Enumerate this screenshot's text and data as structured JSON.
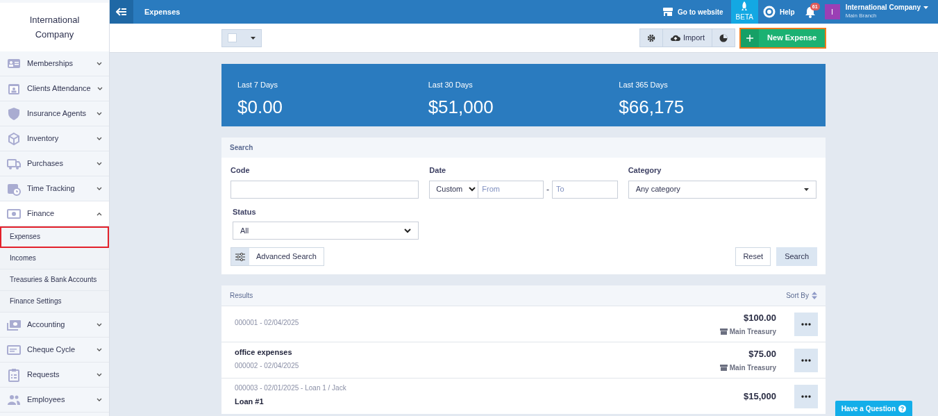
{
  "sidebar": {
    "company": "International Company",
    "items": [
      {
        "label": "Memberships",
        "expanded": false
      },
      {
        "label": "Clients Attendance",
        "expanded": false
      },
      {
        "label": "Insurance Agents",
        "expanded": false
      },
      {
        "label": "Inventory",
        "expanded": false
      },
      {
        "label": "Purchases",
        "expanded": false
      },
      {
        "label": "Time Tracking",
        "expanded": false
      },
      {
        "label": "Finance",
        "expanded": true,
        "children": [
          {
            "label": "Expenses",
            "selected": true
          },
          {
            "label": "Incomes",
            "selected": false
          },
          {
            "label": "Treasuries & Bank Accounts",
            "selected": false
          },
          {
            "label": "Finance Settings",
            "selected": false
          }
        ]
      },
      {
        "label": "Accounting",
        "expanded": false
      },
      {
        "label": "Cheque Cycle",
        "expanded": false
      },
      {
        "label": "Requests",
        "expanded": false
      },
      {
        "label": "Employees",
        "expanded": false
      }
    ]
  },
  "topbar": {
    "title": "Expenses",
    "website": "Go to website",
    "beta": "BETA",
    "help": "Help",
    "notifications": "61",
    "avatar": "I",
    "company": "International Company",
    "branch": "Main Branch"
  },
  "toolbar": {
    "select_all": {
      "checked": false
    },
    "import": "Import",
    "new": "New Expense"
  },
  "stats": [
    {
      "label": "Last 7 Days",
      "value": "$0.00"
    },
    {
      "label": "Last 30 Days",
      "value": "$51,000"
    },
    {
      "label": "Last 365 Days",
      "value": "$66,175"
    }
  ],
  "search": {
    "title": "Search",
    "code_label": "Code",
    "date_label": "Date",
    "date_mode": "Custom",
    "from_placeholder": "From",
    "separator": "-",
    "to_placeholder": "To",
    "category_label": "Category",
    "category": "Any category",
    "status_label": "Status",
    "status": "All",
    "advanced": "Advanced Search",
    "reset": "Reset",
    "submit": "Search"
  },
  "results": {
    "title": "Results",
    "sort": "Sort By",
    "rows": [
      {
        "lines": [
          {
            "kind": "meta",
            "text": "000001 - 02/04/2025"
          }
        ],
        "amount": "$100.00",
        "treasury": "Main Treasury"
      },
      {
        "lines": [
          {
            "kind": "title",
            "text": "office expenses"
          },
          {
            "kind": "meta",
            "text": "000002 - 02/04/2025"
          }
        ],
        "amount": "$75.00",
        "treasury": "Main Treasury"
      },
      {
        "lines": [
          {
            "kind": "meta",
            "text": "000003 - 02/01/2025 - Loan 1 / Jack"
          },
          {
            "kind": "title",
            "text": "Loan #1"
          }
        ],
        "amount": "$15,000"
      }
    ]
  },
  "help_button": "Have a Question"
}
